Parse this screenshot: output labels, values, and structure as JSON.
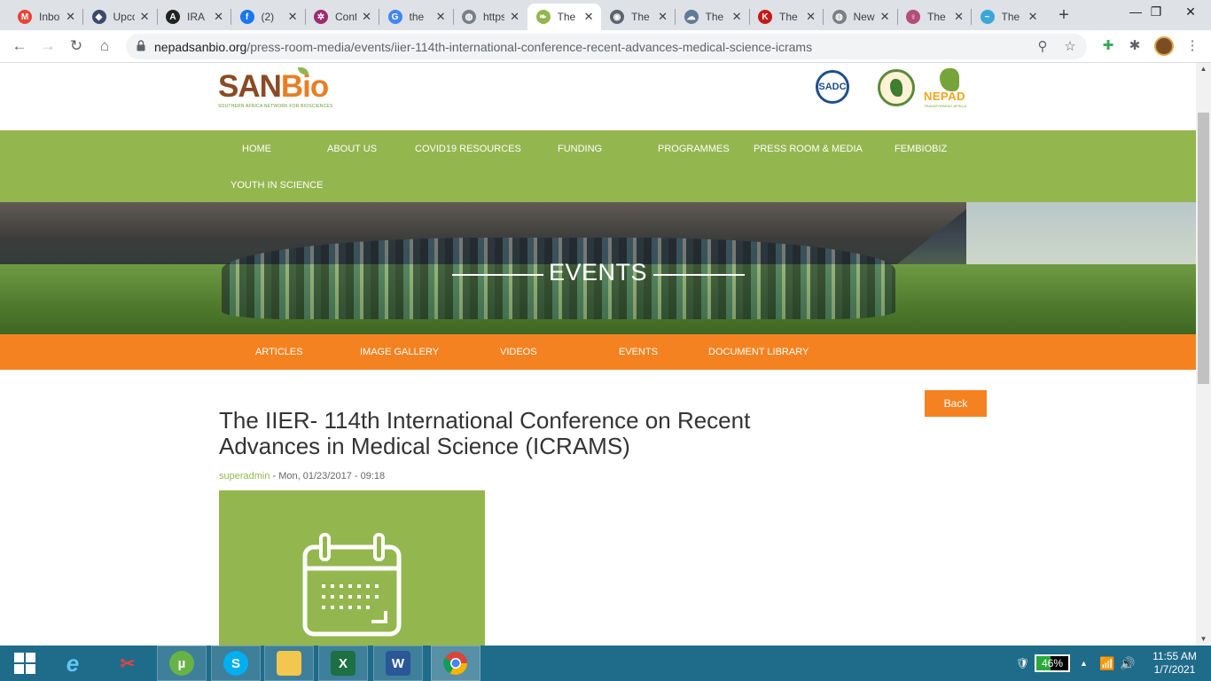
{
  "browser": {
    "tabs": [
      {
        "title": "Inbox",
        "icon": "gmail-icon",
        "color": "#ea4335",
        "glyph": "M",
        "active": false
      },
      {
        "title": "Upcoming",
        "icon": "shield-icon",
        "color": "#3b4a6b",
        "glyph": "◆",
        "active": false
      },
      {
        "title": "IRA",
        "icon": "ira-icon",
        "color": "#222222",
        "glyph": "A",
        "active": false
      },
      {
        "title": "(2)",
        "icon": "facebook-icon",
        "color": "#1877f2",
        "glyph": "f",
        "active": false
      },
      {
        "title": "Conference",
        "icon": "conference-icon",
        "color": "#9c2b6e",
        "glyph": "✲",
        "active": false
      },
      {
        "title": "the",
        "icon": "google-icon",
        "color": "#4285f4",
        "glyph": "G",
        "active": false
      },
      {
        "title": "https",
        "icon": "globe-icon",
        "color": "#7b7f86",
        "glyph": "◍",
        "active": false
      },
      {
        "title": "The",
        "icon": "leaf-icon",
        "color": "#94b64e",
        "glyph": "❧",
        "active": true
      },
      {
        "title": "The",
        "icon": "globe-dark-icon",
        "color": "#5b6470",
        "glyph": "◉",
        "active": false
      },
      {
        "title": "The",
        "icon": "cloud-icon",
        "color": "#607a99",
        "glyph": "☁",
        "active": false
      },
      {
        "title": "The",
        "icon": "k-icon",
        "color": "#c41a1a",
        "glyph": "K",
        "active": false
      },
      {
        "title": "New",
        "icon": "globe-icon",
        "color": "#7b7f86",
        "glyph": "◍",
        "active": false
      },
      {
        "title": "The",
        "icon": "ribbon-icon",
        "color": "#b34d7a",
        "glyph": "♀",
        "active": false
      },
      {
        "title": "The",
        "icon": "wave-icon",
        "color": "#3aa7d6",
        "glyph": "~",
        "active": false
      }
    ],
    "new_tab": "+",
    "window_controls": {
      "minimize": "—",
      "maximize": "❐",
      "close": "✕"
    },
    "url_domain": "nepadsanbio.org",
    "url_path": "/press-room-media/events/iier-114th-international-conference-recent-advances-medical-science-icrams"
  },
  "site": {
    "logo_san": "SAN",
    "logo_bio": "Bio",
    "logo_tagline": "SOUTHERN AFRICA NETWORK FOR BIOSCIENCES",
    "sadc_logo": "SADC",
    "nepad_word": "NEPAD",
    "nepad_tagline": "TRANSFORMING AFRICA",
    "main_nav": [
      "HOME",
      "ABOUT US",
      "COVID19 RESOURCES",
      "FUNDING",
      "PROGRAMMES",
      "PRESS ROOM & MEDIA",
      "FEMBIOBIZ",
      "YOUTH IN SCIENCE"
    ],
    "hero_title": "EVENTS",
    "sub_nav": [
      "ARTICLES",
      "IMAGE GALLERY",
      "VIDEOS",
      "EVENTS",
      "DOCUMENT LIBRARY"
    ],
    "back_label": "Back",
    "article_title": "The IIER- 114th International Conference on Recent Advances in Medical Science (ICRAMS)",
    "author": "superadmin",
    "date": " - Mon, 01/23/2017 - 09:18",
    "colors": {
      "green": "#94b64e",
      "orange": "#f58220"
    }
  },
  "taskbar": {
    "battery": "46%",
    "time": "11:55 AM",
    "date": "1/7/2021"
  }
}
